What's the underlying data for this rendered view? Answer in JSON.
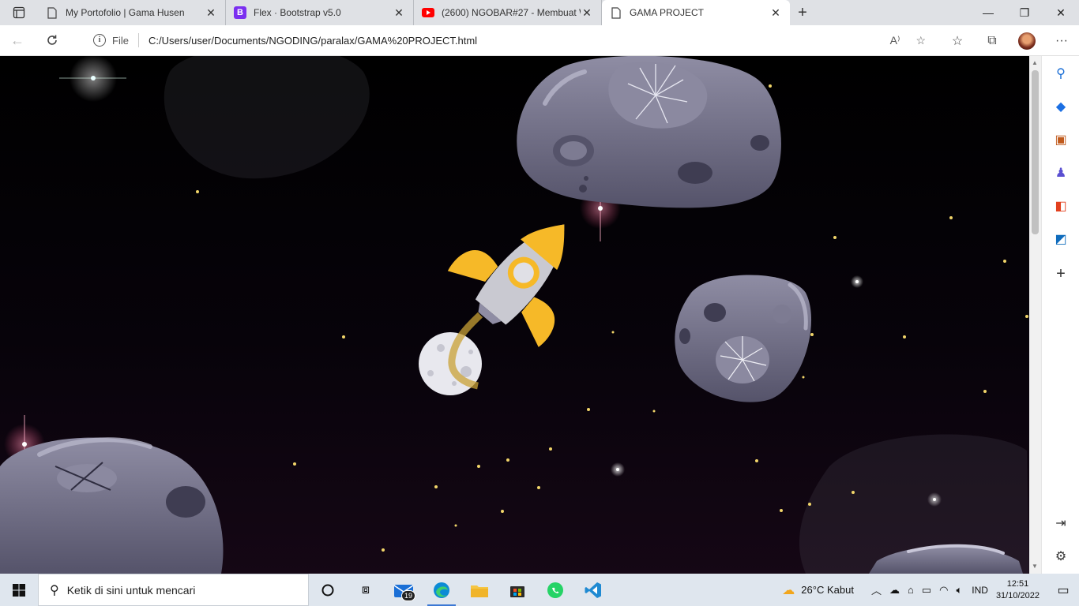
{
  "tabs": [
    {
      "title": "My Portofolio | Gama Husen",
      "icon": "page-icon"
    },
    {
      "title": "Flex · Bootstrap v5.0",
      "icon": "bootstrap-icon"
    },
    {
      "title": "(2600) NGOBAR#27 - Membuat W",
      "icon": "youtube-icon"
    },
    {
      "title": "GAMA PROJECT",
      "icon": "page-icon",
      "active": true
    }
  ],
  "address": {
    "file_label": "File",
    "url": "C:/Users/user/Documents/NGODING/paralax/GAMA%20PROJECT.html"
  },
  "taskbar": {
    "search_placeholder": "Ketik di sini untuk mencari",
    "mail_badge": "19",
    "weather": "26°C  Kabut",
    "language": "IND",
    "time": "12:51",
    "date": "31/10/2022"
  },
  "colors": {
    "space_top": "#000000",
    "space_bottom": "#150715",
    "asteroid": "#6e6c82",
    "rocket_yellow": "#f6b928",
    "rocket_body": "#c9c9d1"
  }
}
